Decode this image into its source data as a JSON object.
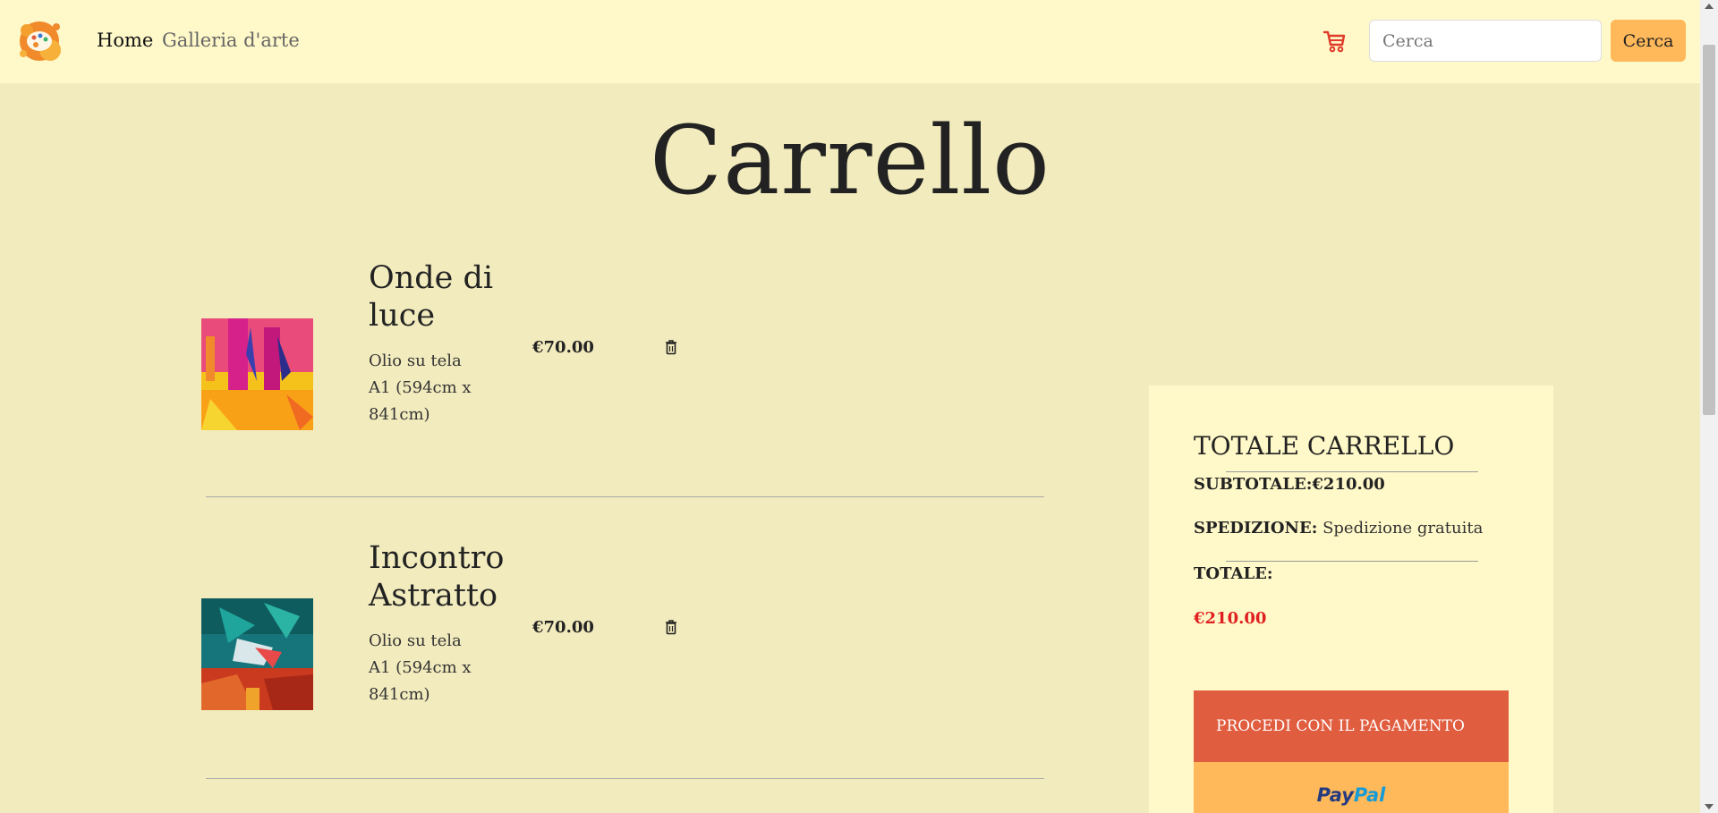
{
  "nav": {
    "home_label": "Home",
    "gallery_label": "Galleria d'arte",
    "search_placeholder": "Cerca",
    "search_button": "Cerca"
  },
  "page": {
    "title": "Carrello"
  },
  "items": [
    {
      "name": "Onde di luce",
      "technique": "Olio su tela",
      "size": "A1 (594cm x 841cm)",
      "price": "€70.00"
    },
    {
      "name": "Incontro Astratto",
      "technique": "Olio su tela",
      "size": "A1 (594cm x 841cm)",
      "price": "€70.00"
    }
  ],
  "totals": {
    "title": "TOTALE CARRELLO",
    "subtotal_label": "SUBTOTALE:",
    "subtotal_value": "€210.00",
    "shipping_label": "SPEDIZIONE:",
    "shipping_value": "Spedizione gratuita",
    "total_label": "TOTALE:",
    "total_value": "€210.00",
    "checkout_button": "PROCEDI CON IL PAGAMENTO",
    "paypal_part1": "Pay",
    "paypal_part2": "Pal"
  },
  "colors": {
    "page_bg": "#f2ebbd",
    "nav_bg": "#fff8c8",
    "accent_orange": "#ffb95a",
    "checkout_red": "#e05d3f",
    "total_red": "#e02020",
    "cart_icon": "#e03a2a"
  },
  "icons": [
    "palette-logo-icon",
    "cart-icon",
    "trash-icon"
  ]
}
